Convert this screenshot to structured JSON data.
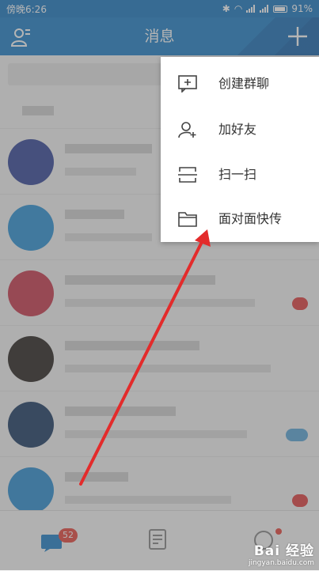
{
  "status_bar": {
    "left_text": "傍晚6:26",
    "battery": "91%"
  },
  "header": {
    "title": "消息"
  },
  "menu": {
    "items": [
      {
        "label": "创建群聊",
        "icon": "add-chat-icon"
      },
      {
        "label": "加好友",
        "icon": "add-friend-icon"
      },
      {
        "label": "扫一扫",
        "icon": "scan-icon"
      },
      {
        "label": "面对面快传",
        "icon": "folder-icon"
      }
    ]
  },
  "bottom_nav": {
    "message_badge": "52"
  },
  "watermark": {
    "main": "Bai 经验",
    "sub": "jingyan.baidu.com"
  },
  "colors": {
    "header_bg": "#1f80c8",
    "badge": "#e8453c",
    "arrow": "#e32b2b"
  }
}
